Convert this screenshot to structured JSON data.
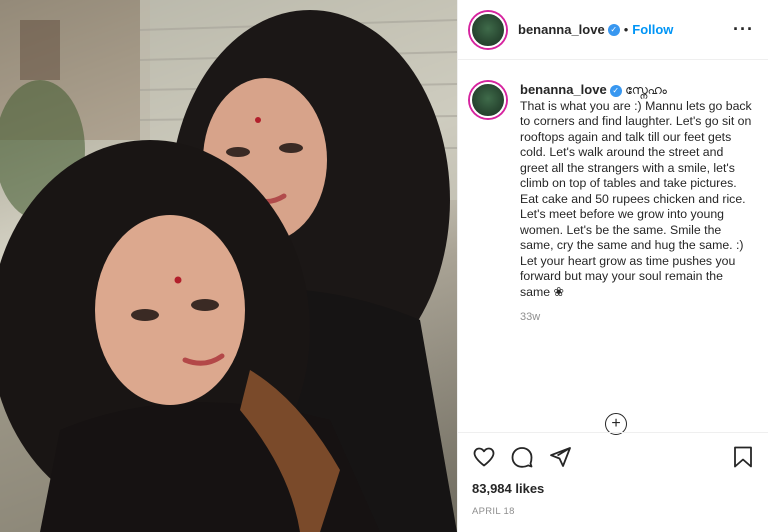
{
  "post": {
    "username": "benanna_love",
    "verified_icon": "verified-badge-icon",
    "separator": "•",
    "follow_label": "Follow",
    "more_icon": "more-options-icon"
  },
  "caption": {
    "username": "benanna_love",
    "title": "സ്നേഹം",
    "text": "That is what you are :) Mannu lets go back to corners and find laughter. Let's go sit on rooftops again and talk till our feet gets cold. Let's walk around the street and greet all the strangers with a smile, let's climb on top of tables and take pictures. Eat cake and 50 rupees chicken and rice. Let's meet before we grow into young women. Let's be the same. Smile the same, cry the same and hug the same. :)\nLet your heart grow as time pushes you forward but may your soul remain the same ❀",
    "time_ago": "33w"
  },
  "load_more_icon": "add-circle-icon",
  "actions": {
    "icons": [
      "heart-icon",
      "comment-icon",
      "share-icon",
      "bookmark-icon"
    ],
    "likes": "83,984 likes",
    "date": "APRIL 18"
  },
  "colors": {
    "accent": "#0095f6",
    "verified": "#3897f0",
    "text": "#262626",
    "muted": "#8e8e8e",
    "border": "#efefef"
  }
}
